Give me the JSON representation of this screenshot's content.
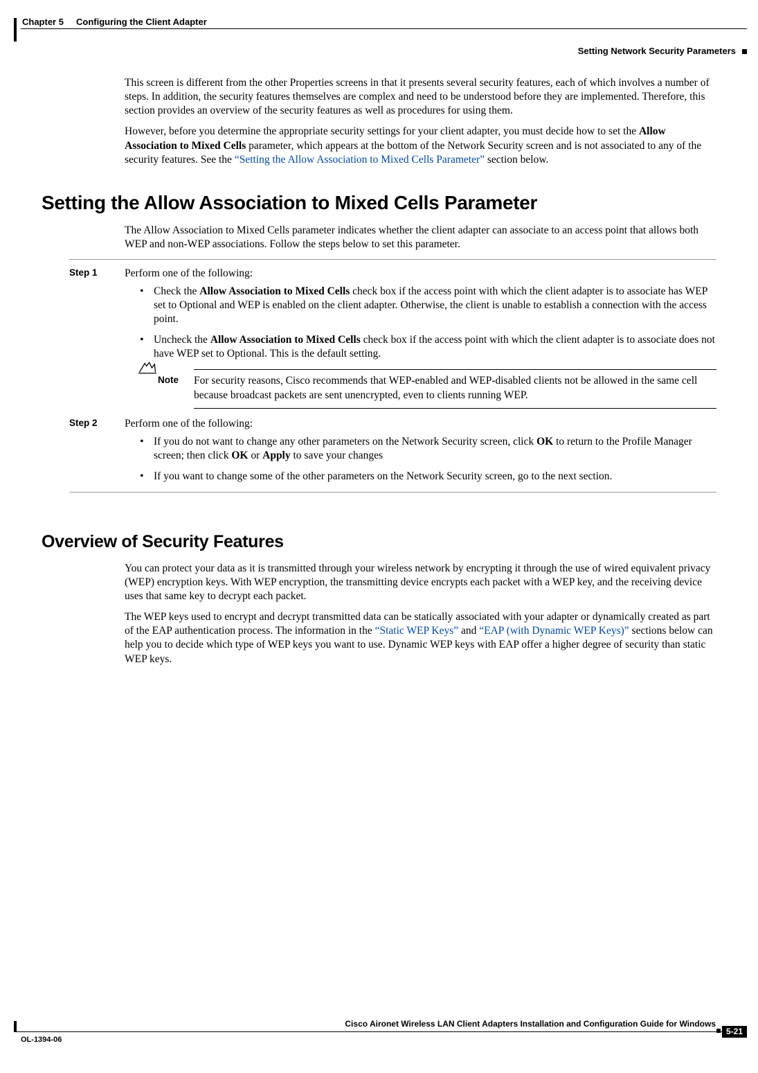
{
  "header": {
    "chapter": "Chapter 5",
    "title": "Configuring the Client Adapter",
    "section": "Setting Network Security Parameters"
  },
  "intro": {
    "p1_a": "This screen is different from the other Properties screens in that it presents several security features, each of which involves a number of steps. In addition, the security features themselves are complex and need to be understood before they are implemented. Therefore, this section provides an overview of the security features as well as procedures for using them.",
    "p2_a": "However, before you determine the appropriate security settings for your client adapter, you must decide how to set the ",
    "p2_bold": "Allow Association to Mixed Cells",
    "p2_b": " parameter, which appears at the bottom of the Network Security screen and is not associated to any of the security features. See the ",
    "p2_link": "“Setting the Allow Association to Mixed Cells Parameter”",
    "p2_c": " section below."
  },
  "sect1": {
    "heading": "Setting the Allow Association to Mixed Cells Parameter",
    "p1": "The Allow Association to Mixed Cells parameter indicates whether the client adapter can associate to an access point that allows both WEP and non-WEP associations. Follow the steps below to set this parameter."
  },
  "step1": {
    "label": "Step 1",
    "text": "Perform one of the following:",
    "b1_a": "Check the ",
    "b1_bold": "Allow Association to Mixed Cells",
    "b1_b": " check box if the access point with which the client adapter is to associate has WEP set to Optional and WEP is enabled on the client adapter. Otherwise, the client is unable to establish a connection with the access point.",
    "b2_a": "Uncheck the ",
    "b2_bold": "Allow Association to Mixed Cells",
    "b2_b": " check box if the access point with which the client adapter is to associate does not have WEP set to Optional. This is the default setting."
  },
  "note": {
    "label": "Note",
    "text": "For security reasons, Cisco recommends that WEP-enabled and WEP-disabled clients not be allowed in the same cell because broadcast packets are sent unencrypted, even to clients running WEP."
  },
  "step2": {
    "label": "Step 2",
    "text": "Perform one of the following:",
    "b1_a": "If you do not want to change any other parameters on the Network Security screen, click ",
    "b1_bold1": "OK",
    "b1_b": " to return to the Profile Manager screen; then click ",
    "b1_bold2": "OK",
    "b1_c": " or ",
    "b1_bold3": "Apply",
    "b1_d": " to save your changes",
    "b2": "If you want to change some of the other parameters on the Network Security screen, go to the next section."
  },
  "sect2": {
    "heading": "Overview of Security Features",
    "p1": "You can protect your data as it is transmitted through your wireless network by encrypting it through the use of wired equivalent privacy (WEP) encryption keys. With WEP encryption, the transmitting device encrypts each packet with a WEP key, and the receiving device uses that same key to decrypt each packet.",
    "p2_a": "The WEP keys used to encrypt and decrypt transmitted data can be statically associated with your adapter or dynamically created as part of the EAP authentication process. The information in the ",
    "p2_link1": "“Static WEP Keys”",
    "p2_b": " and ",
    "p2_link2": "“EAP (with Dynamic WEP Keys)”",
    "p2_c": " sections below can help you to decide which type of WEP keys you want to use. Dynamic WEP keys with EAP offer a higher degree of security than static WEP keys."
  },
  "footer": {
    "book": "Cisco Aironet Wireless LAN Client Adapters Installation and Configuration Guide for Windows",
    "doc": "OL-1394-06",
    "page": "5-21"
  }
}
